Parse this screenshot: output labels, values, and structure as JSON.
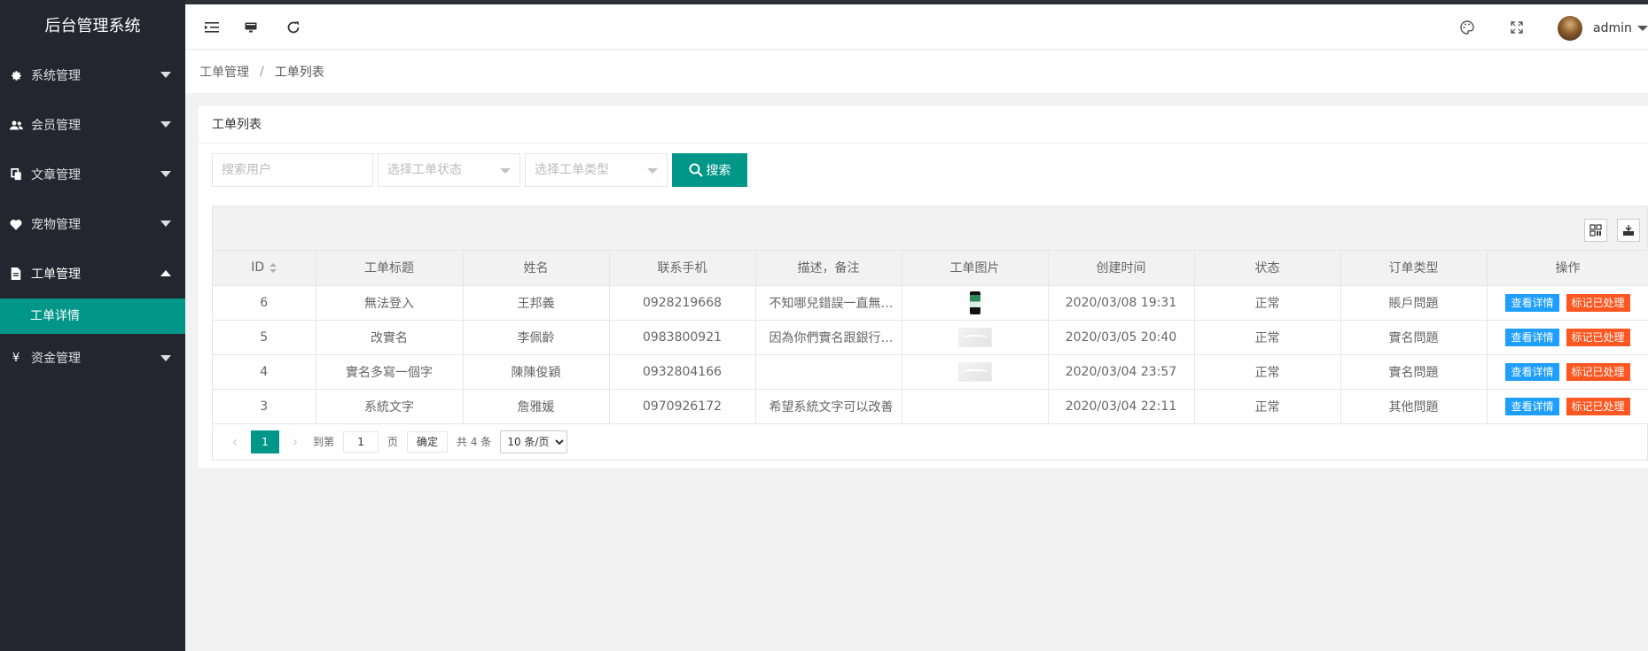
{
  "app": {
    "title": "后台管理系统"
  },
  "sidebar": {
    "items": [
      {
        "label": "系统管理",
        "icon": "gear-icon",
        "open": false
      },
      {
        "label": "会员管理",
        "icon": "users-icon",
        "open": false
      },
      {
        "label": "文章管理",
        "icon": "documents-icon",
        "open": false
      },
      {
        "label": "宠物管理",
        "icon": "heart-icon",
        "open": false
      },
      {
        "label": "工单管理",
        "icon": "file-icon",
        "open": true
      },
      {
        "label": "资金管理",
        "icon": "yen-icon",
        "open": false
      }
    ],
    "sub_items": [
      {
        "label": "工单详情",
        "active": true
      }
    ],
    "yen_symbol": "¥"
  },
  "header": {
    "user": "admin"
  },
  "breadcrumb": {
    "parent": "工单管理",
    "separator": "/",
    "current": "工单列表"
  },
  "card": {
    "title": "工单列表"
  },
  "filters": {
    "user_placeholder": "搜索用户",
    "status_placeholder": "选择工单状态",
    "type_placeholder": "选择工单类型",
    "search_label": "搜索"
  },
  "table": {
    "columns": [
      "ID",
      "工单标题",
      "姓名",
      "联系手机",
      "描述，备注",
      "工单图片",
      "创建时间",
      "状态",
      "订单类型",
      "操作"
    ],
    "rows": [
      {
        "id": "6",
        "title": "無法登入",
        "name": "王邦義",
        "phone": "0928219668",
        "desc": "不知哪兒錯誤一直無法登入",
        "image": "phone",
        "created": "2020/03/08 19:31",
        "status": "正常",
        "type": "賬戶問題"
      },
      {
        "id": "5",
        "title": "改實名",
        "name": "李佩齡",
        "phone": "0983800921",
        "desc": "因為你們實名跟銀行不符",
        "image": "placeholder",
        "created": "2020/03/05 20:40",
        "status": "正常",
        "type": "實名問題"
      },
      {
        "id": "4",
        "title": "實名多寫一個字",
        "name": "陳陳俊穎",
        "phone": "0932804166",
        "desc": "",
        "image": "placeholder",
        "created": "2020/03/04 23:57",
        "status": "正常",
        "type": "實名問題"
      },
      {
        "id": "3",
        "title": "系統文字",
        "name": "詹雅媛",
        "phone": "0970926172",
        "desc": "希望系統文字可以改善",
        "image": "",
        "created": "2020/03/04 22:11",
        "status": "正常",
        "type": "其他問題"
      }
    ],
    "view_label": "查看详情",
    "mark_label": "标记已处理"
  },
  "pager": {
    "current": "1",
    "goto_label": "到第",
    "goto_value": "1",
    "page_unit": "页",
    "confirm_label": "确定",
    "total_label": "共 4 条",
    "size_option": "10 条/页"
  },
  "colors": {
    "sidebar_bg": "#23262e",
    "accent": "#009688",
    "view_button": "#1e9fff",
    "mark_button": "#ff5722"
  }
}
